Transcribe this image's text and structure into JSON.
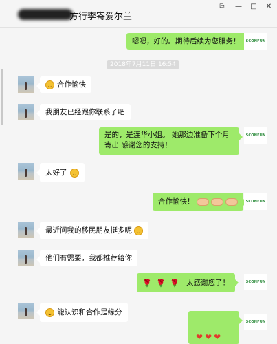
{
  "window": {
    "title": "方行李寄爱尔兰",
    "controls": [
      "⧉",
      "—",
      "□",
      "✕"
    ]
  },
  "chat": {
    "timestamp": "2018年7月11日 16:54",
    "brand_avatar": "SCONFUN",
    "messages": [
      {
        "side": "out",
        "text": "嗯嗯，好的。期待后续为您服务！"
      },
      {
        "side": "in",
        "text": "合作愉快",
        "emoji": "smile"
      },
      {
        "side": "in",
        "text": "我朋友已经跟你联系了吧"
      },
      {
        "side": "out",
        "text": "是的，是连华小姐。 她那边准备下个月寄出 感谢您的支持！"
      },
      {
        "side": "in",
        "text": "太好了",
        "emoji": "grin"
      },
      {
        "side": "out",
        "text": "合作愉快！",
        "emoji": "handshake"
      },
      {
        "side": "in",
        "text": "最近问我的移民朋友挺多呢",
        "emoji": "thinking"
      },
      {
        "side": "in",
        "text": "他们有需要，我都推荐给你"
      },
      {
        "side": "out",
        "text": "太感谢您了！",
        "emoji": "rose"
      },
      {
        "side": "in",
        "text": "能认识和合作是缘分",
        "emoji": "wink"
      },
      {
        "side": "out",
        "text": "",
        "emoji": "heart"
      }
    ]
  }
}
